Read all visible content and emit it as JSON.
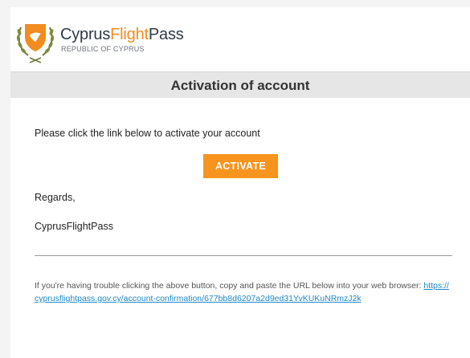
{
  "brand": {
    "name_part1": "Cyprus",
    "name_part2": "Flight",
    "name_part3": "Pass",
    "subtitle": "REPUBLIC OF CYPRUS",
    "logo_icon": "cyprus-coat-of-arms-icon"
  },
  "title_bar": {
    "title": "Activation of account"
  },
  "body": {
    "intro": "Please click the link below to activate your account",
    "activate_label": "ACTIVATE",
    "regards": "Regards,",
    "signature": "CyprusFlightPass"
  },
  "footer": {
    "help_text": "If you're having trouble clicking the above button, copy and paste the URL below into your web browser:",
    "url": "https://cyprusflightpass.gov.cy/account-confirmation/677bb8d6207a2d9ed31YvKUKuNRmzJ2k"
  },
  "colors": {
    "accent": "#f7941d",
    "brand_orange": "#f28c1e",
    "link": "#1e88c8",
    "title_bar": "#e6e6e6"
  }
}
